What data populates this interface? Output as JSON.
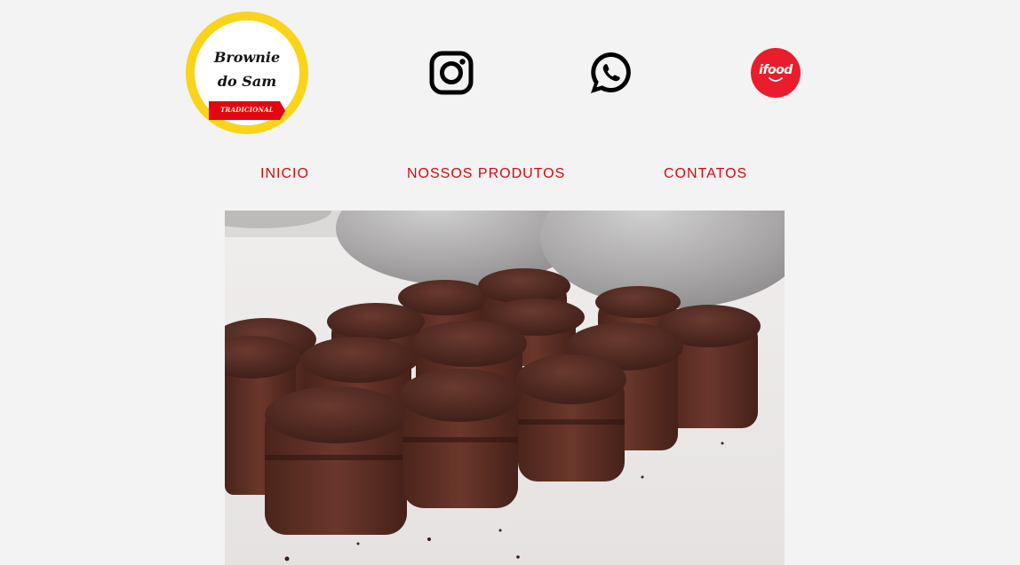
{
  "brand": {
    "logo_line1": "Brownie",
    "logo_line2": "do Sam",
    "logo_ribbon": "TRADICIONAL",
    "colors": {
      "logo_ring": "#fad41b",
      "ribbon": "#e30613",
      "nav_link": "#d10a11",
      "ifood": "#ea1d2c"
    }
  },
  "social": {
    "instagram_icon": "instagram-icon",
    "whatsapp_icon": "whatsapp-icon",
    "ifood_icon": "ifood-icon",
    "ifood_label": "ifood"
  },
  "nav": {
    "inicio": "INICIO",
    "produtos": "NOSSOS PRODUTOS",
    "contatos": "CONTATOS"
  },
  "hero": {
    "image": "brownie-photo"
  }
}
